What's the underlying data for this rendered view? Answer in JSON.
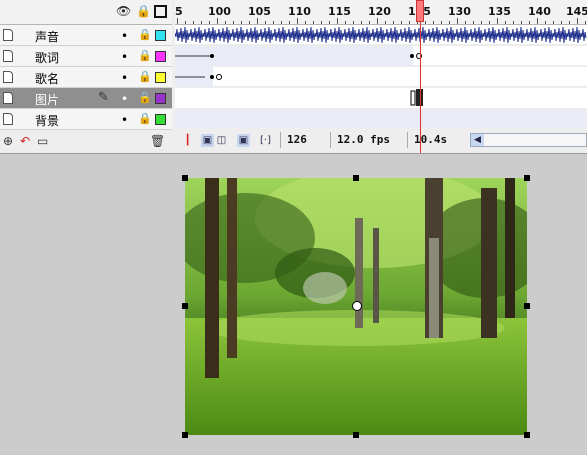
{
  "layers": [
    {
      "name": "声音",
      "color": "#33e3ef",
      "selected": false,
      "editing": false
    },
    {
      "name": "歌词",
      "color": "#ff33ff",
      "selected": false,
      "editing": false
    },
    {
      "name": "歌名",
      "color": "#ffff33",
      "selected": false,
      "editing": false
    },
    {
      "name": "图片",
      "color": "#9933cc",
      "selected": true,
      "editing": true
    },
    {
      "name": "背景",
      "color": "#33dd33",
      "selected": false,
      "editing": false
    }
  ],
  "ruler": {
    "labels": [
      "5",
      "100",
      "105",
      "110",
      "115",
      "120",
      "125",
      "130",
      "135",
      "140",
      "145"
    ]
  },
  "status": {
    "current_frame": "126",
    "frame_rate": "12.0 fps",
    "elapsed": "10.4s"
  },
  "colors": {
    "playhead": "#e03030",
    "selected_layer": "#8f8f8f",
    "waveform": "#1a2a8a"
  },
  "icons": {
    "header": [
      "eye-icon",
      "lock-icon",
      "outline-icon"
    ],
    "layer_tools": [
      "insert-layer-icon",
      "add-motion-guide-icon",
      "insert-folder-icon",
      "delete-layer-icon"
    ],
    "frame_tools": [
      "center-frame-icon",
      "onion-skin-icon",
      "onion-skin-outlines-icon",
      "edit-multiple-frames-icon",
      "modify-markers-icon"
    ]
  }
}
